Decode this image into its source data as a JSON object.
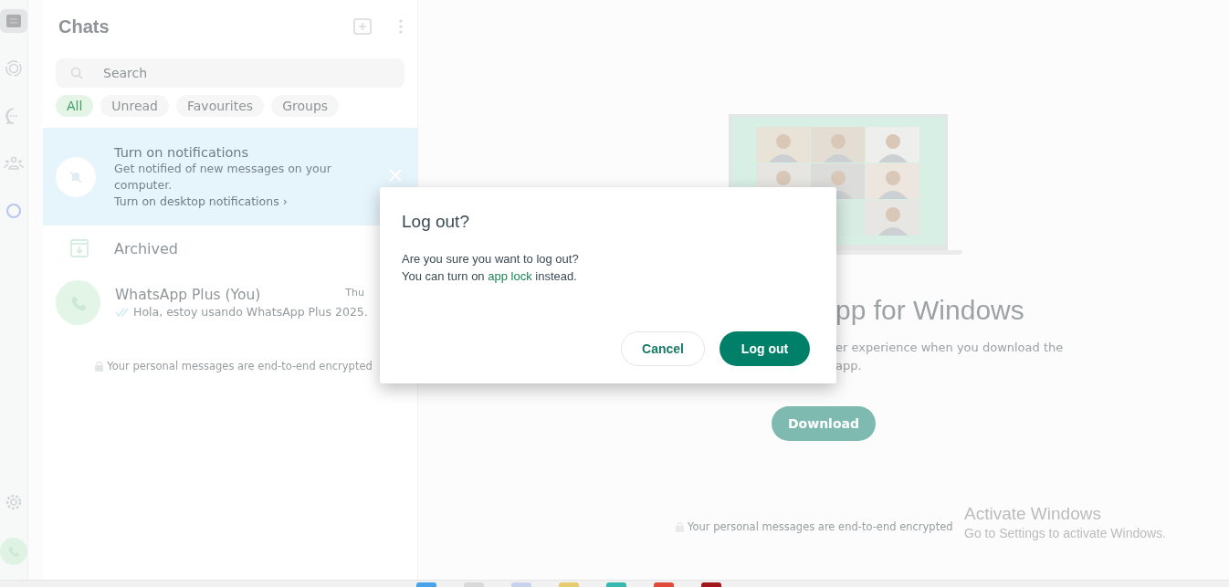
{
  "rail": {
    "top": [
      {
        "kind": "chats",
        "selected": true
      },
      {
        "kind": "status",
        "selected": false
      },
      {
        "kind": "channels",
        "selected": false
      },
      {
        "kind": "communities",
        "selected": false
      },
      {
        "kind": "ai",
        "selected": false
      }
    ],
    "bottom": [
      {
        "kind": "settings",
        "selected": false
      },
      {
        "kind": "profile",
        "selected": false
      }
    ]
  },
  "chats": {
    "title": "Chats",
    "search": {
      "placeholder": "Search"
    },
    "filters": [
      {
        "label": "All",
        "selected": true
      },
      {
        "label": "Unread",
        "selected": false
      },
      {
        "label": "Favourites",
        "selected": false
      },
      {
        "label": "Groups",
        "selected": false
      }
    ],
    "banner": {
      "title": "Turn on notifications",
      "text": "Get notified of new messages on your computer.",
      "link": "Turn on desktop notifications ›"
    },
    "archived": "Archived",
    "rows": [
      {
        "name": "WhatsApp Plus (You)",
        "time": "Thu",
        "preview": "Hola, estoy usando WhatsApp Plus 2025.",
        "read": true
      }
    ],
    "note": "Your personal messages are end-to-end encrypted"
  },
  "main": {
    "title": "pp for Windows",
    "subtitle": [
      "er experience when you download the",
      "app."
    ],
    "button": "Download",
    "note": "Your personal messages are end-to-end encrypted"
  },
  "dialog": {
    "title": "Log out?",
    "line1": "Are you sure you want to log out?",
    "line2_before": "You can turn on",
    "link": "app lock",
    "line2_after": "instead.",
    "buttons": [
      {
        "label": "Cancel",
        "kind": "secondary"
      },
      {
        "label": "Log out",
        "kind": "primary"
      }
    ]
  },
  "activation": {
    "title": "Activate Windows",
    "text": "Go to Settings to activate Windows."
  }
}
